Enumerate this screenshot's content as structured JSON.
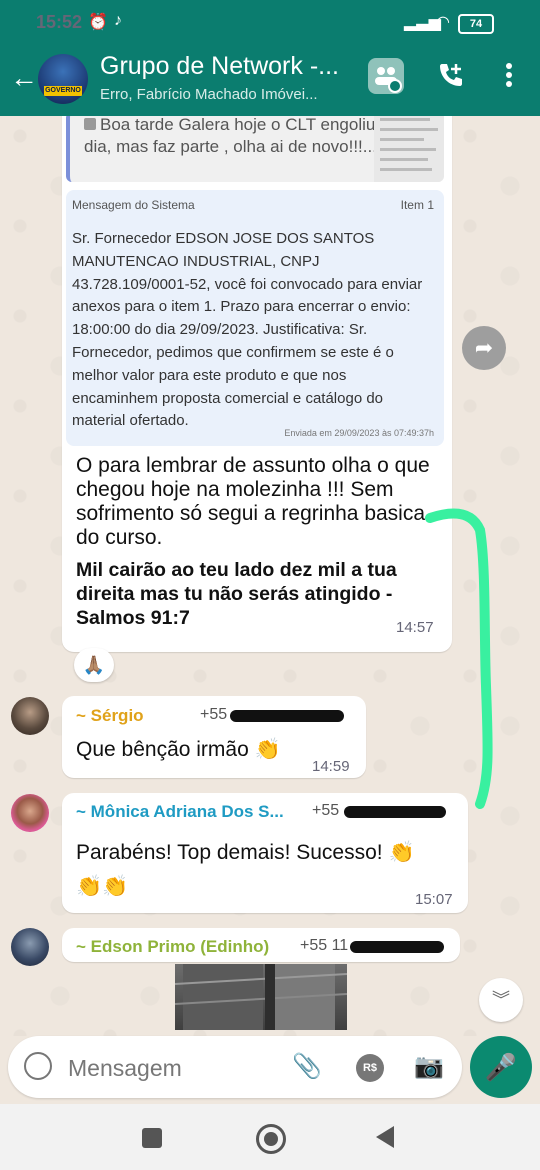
{
  "status_bar": {
    "time": "15:52",
    "battery": "74"
  },
  "header": {
    "title": "Grupo de Network -...",
    "subtitle": "Erro, Fabrício Machado Imóvei...",
    "avatar_badge": "GOVERNO"
  },
  "quoted": {
    "text": "Boa tarde Galera hoje o CLT engoliu meu dia, mas faz parte , olha  ai de novo!!!..."
  },
  "system_card": {
    "header": "Mensagem do Sistema",
    "item": "Item 1",
    "body": "Sr. Fornecedor EDSON JOSE DOS SANTOS MANUTENCAO INDUSTRIAL, CNPJ 43.728.109/0001-52, você foi convocado para enviar anexos para o item 1. Prazo para encerrar o envio: 18:00:00 do dia 29/09/2023. Justificativa: Sr. Fornecedor, pedimos que confirmem se este é o melhor valor para este produto e que nos encaminhem proposta comercial e catálogo do material ofertado.",
    "sent": "Enviada em 29/09/2023 às 07:49:37h"
  },
  "main_message": {
    "text": "O para lembrar de assunto olha o que chegou hoje na molezinha !!! Sem sofrimento só segui a regrinha basica do curso.",
    "bold_text": "Mil cairão ao teu lado dez mil a tua direita mas tu não serás atingido - Salmos 91:7",
    "time": "14:57",
    "reaction": "🙏🏽"
  },
  "messages": [
    {
      "sender": "~ Sérgio",
      "phone": "+55",
      "text": "Que bênção irmão 👏",
      "time": "14:59",
      "sender_color": "#e0a21a"
    },
    {
      "sender": "~ Mônica Adriana Dos S...",
      "phone": "+55",
      "text": "Parabéns! Top demais! Sucesso! 👏 👏👏",
      "time": "15:07",
      "sender_color": "#1f9bc3"
    },
    {
      "sender": "~ Edson Primo (Edinho)",
      "phone": "+55 11",
      "sender_color": "#8fb33a"
    }
  ],
  "composer": {
    "placeholder": "Mensagem",
    "currency_label": "R$"
  },
  "icons": {
    "back": "arrow-left-icon",
    "video": "group-call-icon",
    "call": "add-call-icon",
    "menu": "more-vert-icon",
    "forward": "forward-icon",
    "attach": "paperclip-icon",
    "camera": "camera-icon",
    "mic": "microphone-icon",
    "emoji": "emoji-icon",
    "scroll": "double-chevron-down-icon"
  },
  "colors": {
    "header": "#0b7d6f",
    "accent": "#0b8a70",
    "annotation": "#39f0a0"
  }
}
